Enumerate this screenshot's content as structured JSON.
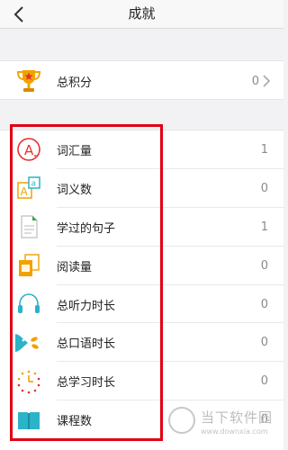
{
  "header": {
    "title": "成就"
  },
  "total": {
    "label": "总积分",
    "value": "0"
  },
  "stats": [
    {
      "label": "词汇量",
      "value": "1",
      "icon": "vocabulary-icon"
    },
    {
      "label": "词义数",
      "value": "0",
      "icon": "word-meaning-icon"
    },
    {
      "label": "学过的句子",
      "value": "1",
      "icon": "sentence-document-icon"
    },
    {
      "label": "阅读量",
      "value": "0",
      "icon": "reading-icon"
    },
    {
      "label": "总听力时长",
      "value": "0",
      "icon": "headphones-icon"
    },
    {
      "label": "总口语时长",
      "value": "0",
      "icon": "speaking-icon"
    },
    {
      "label": "总学习时长",
      "value": "0",
      "icon": "study-timer-icon"
    },
    {
      "label": "课程数",
      "value": "0",
      "icon": "course-book-icon"
    }
  ],
  "watermark": {
    "text": "当下软件园",
    "url": "www.downxia.com"
  },
  "colors": {
    "highlight": "#e00012",
    "accent_red": "#e5322d",
    "accent_orange": "#f3a100",
    "accent_cyan": "#2bb3c7",
    "accent_green": "#3aa640"
  }
}
